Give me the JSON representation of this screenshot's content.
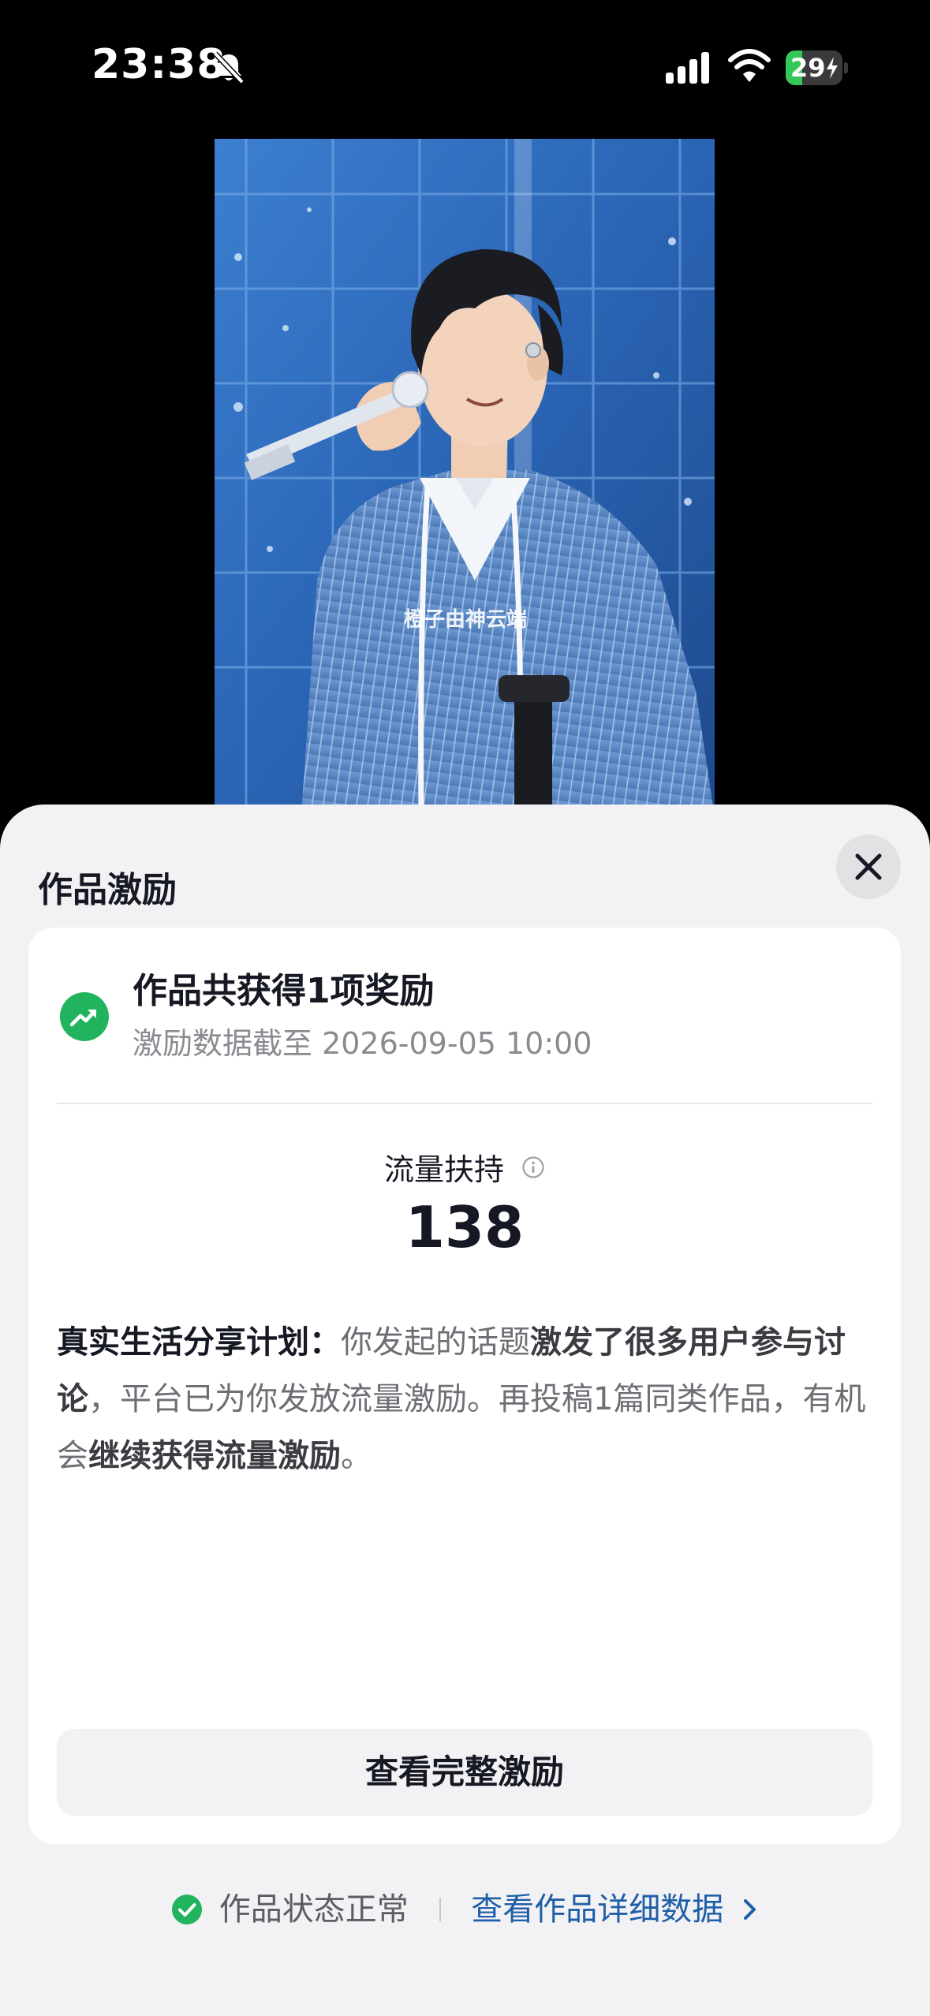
{
  "status_bar": {
    "time": "23:38",
    "battery_level": "29",
    "battery_fraction": 0.29
  },
  "video": {
    "watermark_text": "橙子由神云端"
  },
  "sheet": {
    "title": "作品激励",
    "card": {
      "reward_title": "作品共获得1项奖励",
      "data_as_of": "激励数据截至 2026-09-05 10:00",
      "metric_label": "流量扶持",
      "metric_value": "138",
      "description": {
        "plan_name": "真实生活分享计划：",
        "part1": "你发起的话题",
        "highlight1": "激发了很多用户参与讨论",
        "part2": "，平台已为你发放流量激励。再投稿1篇同类作品，有机会",
        "highlight2": "继续获得流量激励",
        "part3": "。"
      },
      "view_full_button": "查看完整激励"
    },
    "footer": {
      "status_text": "作品状态正常",
      "detail_link": "查看作品详细数据"
    }
  },
  "colors": {
    "accent_green": "#22b35e",
    "link_blue": "#1f5fa8",
    "sheet_bg": "#f2f2f4"
  }
}
